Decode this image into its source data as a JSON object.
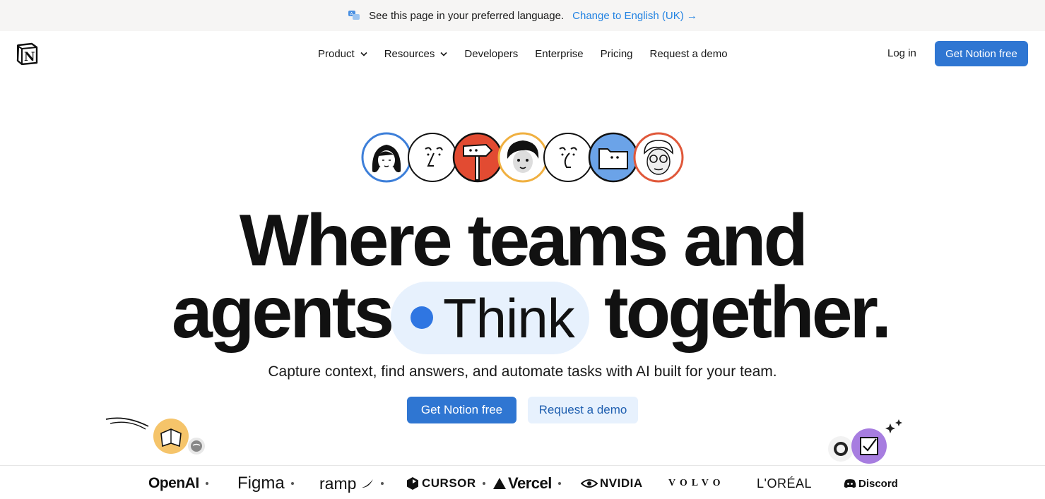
{
  "banner": {
    "message": "See this page in your preferred language.",
    "link": "Change to English (UK) →"
  },
  "nav": {
    "items": [
      {
        "label": "Product",
        "has_dropdown": true
      },
      {
        "label": "Resources",
        "has_dropdown": true
      },
      {
        "label": "Developers",
        "has_dropdown": false
      },
      {
        "label": "Enterprise",
        "has_dropdown": false
      },
      {
        "label": "Pricing",
        "has_dropdown": false
      },
      {
        "label": "Request a demo",
        "has_dropdown": false
      }
    ],
    "login": "Log in",
    "cta": "Get Notion free"
  },
  "hero": {
    "line1": "Where teams and",
    "line2_left": "agents",
    "pill_word": "Think",
    "line2_right": "together.",
    "subtitle": "Capture context, find answers, and automate tasks with AI built for your team.",
    "primary_cta": "Get Notion free",
    "secondary_cta": "Request a demo"
  },
  "logos": [
    "OpenAI",
    "Figma",
    "ramp",
    "CURSOR",
    "Vercel",
    "NVIDIA",
    "VOLVO",
    "L'ORÉAL",
    "Discord"
  ],
  "colors": {
    "accent": "#2f76d2",
    "banner_bg": "#f6f5f4",
    "pill_bg": "#e7f1fd",
    "link": "#2383e2"
  }
}
